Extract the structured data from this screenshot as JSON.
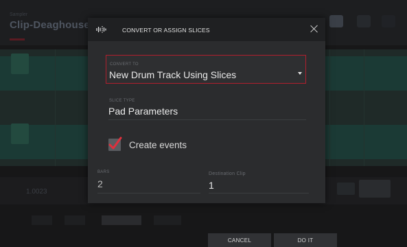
{
  "background": {
    "track_title": "Clip-Deaghouse-Di",
    "track_sub": "Sampler",
    "bar_label": "1.0023"
  },
  "dialog": {
    "title": "CONVERT OR ASSIGN SLICES",
    "title_icon": "slice-waveform-icon",
    "close_icon": "close-icon",
    "convert_to": {
      "label": "CONVERT TO",
      "value": "New Drum Track Using Slices"
    },
    "slice_type": {
      "label": "SLICE TYPE",
      "value": "Pad Parameters"
    },
    "create_events": {
      "label": "Create events",
      "checked": true
    },
    "bars": {
      "label": "BARS",
      "value": "2"
    },
    "destination_clip": {
      "label": "Destination Clip",
      "value": "1"
    }
  },
  "footer": {
    "cancel_label": "CANCEL",
    "doit_label": "DO IT"
  },
  "colors": {
    "accent": "#b21f2d",
    "dialog_bg": "#2b2c2e",
    "header_bg": "#1f2022",
    "checkbox_check": "#e0303d"
  }
}
